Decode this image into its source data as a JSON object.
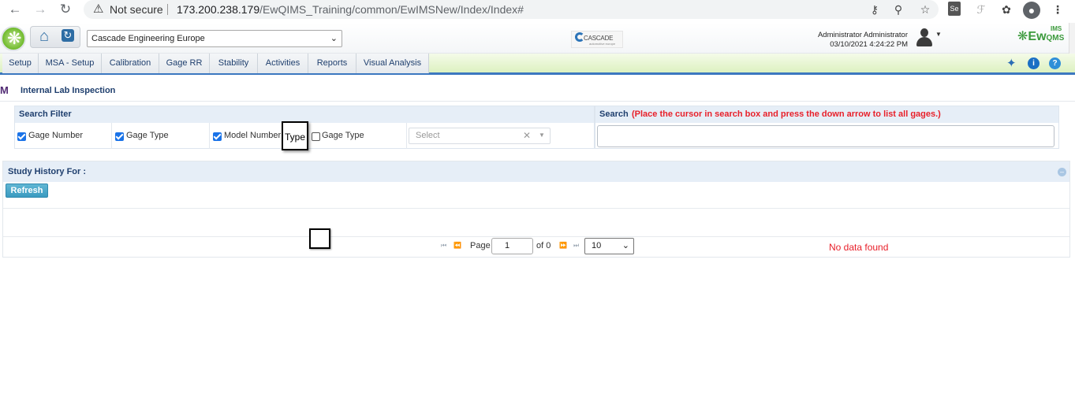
{
  "browser": {
    "not_secure": "Not secure",
    "url_host": "173.200.238.179",
    "url_path": "/EwQIMS_Training/common/EwIMSNew/Index/Index#"
  },
  "header": {
    "organization": "Cascade Engineering Europe",
    "customer_logo_text": "CASCADE",
    "customer_logo_sub": "automotive europe",
    "user_name": "Administrator Administrator",
    "datetime": "03/10/2021 4:24:22 PM",
    "brand": "Ew",
    "brand_suffix": "QMS",
    "brand_top": "IMS"
  },
  "menu": [
    "Setup",
    "MSA - Setup",
    "Calibration",
    "Gage RR",
    "Stability",
    "Activities",
    "Reports",
    "Visual Analysis"
  ],
  "breadcrumb": {
    "title": "Internal Lab Inspection"
  },
  "search_filter": {
    "title": "Search Filter",
    "options": [
      {
        "label": "Gage Number",
        "checked": true
      },
      {
        "label": "Gage Type",
        "checked": true
      },
      {
        "label": "Model Number",
        "checked": true
      },
      {
        "label": "Gage Type",
        "checked": false
      }
    ],
    "select_placeholder": "Select",
    "tooltip": "Type"
  },
  "search": {
    "title": "Search",
    "hint": "(Place the cursor in search box and press the down arrow to list all gages.)"
  },
  "history": {
    "title": "Study History For :",
    "refresh_label": "Refresh",
    "pager": {
      "page_label": "Page",
      "page_value": "1",
      "of_label": "of 0",
      "page_size": "10"
    },
    "empty_message": "No data found"
  },
  "colors": {
    "accent": "#1f3f6e",
    "menu_border": "#3c78c0",
    "alert": "#e8202a",
    "brand": "#3c9a3c"
  }
}
